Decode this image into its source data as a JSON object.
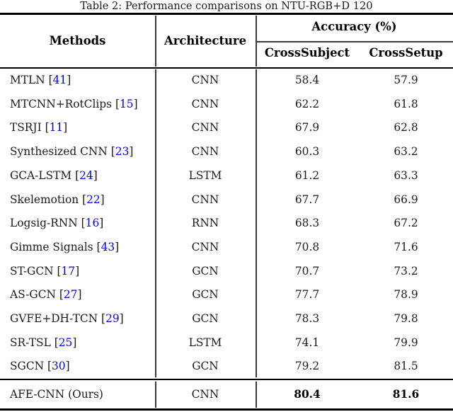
{
  "caption": "Table 2: Performance comparisons on NTU-RGB+D 120",
  "colors": {
    "citation_link": "#0000e0",
    "rule": "#000000",
    "text": "#1a1a1a"
  },
  "header": {
    "methods": "Methods",
    "architecture": "Architecture",
    "accuracy_group": "Accuracy (%)",
    "cross_subject": "CrossSubject",
    "cross_setup": "CrossSetup"
  },
  "rows": [
    {
      "method": "MTLN",
      "ref": "41",
      "architecture": "CNN",
      "cross_subject": "58.4",
      "cross_setup": "57.9"
    },
    {
      "method": "MTCNN+RotClips",
      "ref": "15",
      "architecture": "CNN",
      "cross_subject": "62.2",
      "cross_setup": "61.8"
    },
    {
      "method": "TSRJI",
      "ref": "11",
      "architecture": "CNN",
      "cross_subject": "67.9",
      "cross_setup": "62.8"
    },
    {
      "method": "Synthesized CNN",
      "ref": "23",
      "architecture": "CNN",
      "cross_subject": "60.3",
      "cross_setup": "63.2"
    },
    {
      "method": "GCA-LSTM",
      "ref": "24",
      "architecture": "LSTM",
      "cross_subject": "61.2",
      "cross_setup": "63.3"
    },
    {
      "method": "Skelemotion",
      "ref": "22",
      "architecture": "CNN",
      "cross_subject": "67.7",
      "cross_setup": "66.9"
    },
    {
      "method": "Logsig-RNN",
      "ref": "16",
      "architecture": "RNN",
      "cross_subject": "68.3",
      "cross_setup": "67.2"
    },
    {
      "method": "Gimme Signals",
      "ref": "43",
      "architecture": "CNN",
      "cross_subject": "70.8",
      "cross_setup": "71.6"
    },
    {
      "method": "ST-GCN",
      "ref": "17",
      "architecture": "GCN",
      "cross_subject": "70.7",
      "cross_setup": "73.2"
    },
    {
      "method": "AS-GCN",
      "ref": "27",
      "architecture": "GCN",
      "cross_subject": "77.7",
      "cross_setup": "78.9"
    },
    {
      "method": "GVFE+DH-TCN",
      "ref": "29",
      "architecture": "GCN",
      "cross_subject": "78.3",
      "cross_setup": "79.8"
    },
    {
      "method": "SR-TSL",
      "ref": "25",
      "architecture": "LSTM",
      "cross_subject": "74.1",
      "cross_setup": "79.9"
    },
    {
      "method": "SGCN",
      "ref": "30",
      "architecture": "GCN",
      "cross_subject": "79.2",
      "cross_setup": "81.5"
    }
  ],
  "ours_row": {
    "method": "AFE-CNN (Ours)",
    "ref": null,
    "architecture": "CNN",
    "cross_subject": "80.4",
    "cross_setup": "81.6",
    "bold": true
  },
  "chart_data": {
    "type": "table",
    "title": "Table 2: Performance comparisons on NTU-RGB+D 120",
    "columns": [
      "Methods",
      "Architecture",
      "CrossSubject",
      "CrossSetup"
    ],
    "column_groups": [
      {
        "label": "Accuracy (%)",
        "spans": [
          "CrossSubject",
          "CrossSetup"
        ]
      }
    ],
    "categories": [
      "MTLN [41]",
      "MTCNN+RotClips [15]",
      "TSRJI [11]",
      "Synthesized CNN [23]",
      "GCA-LSTM [24]",
      "Skelemotion [22]",
      "Logsig-RNN [16]",
      "Gimme Signals [43]",
      "ST-GCN [17]",
      "AS-GCN [27]",
      "GVFE+DH-TCN [29]",
      "SR-TSL [25]",
      "SGCN [30]",
      "AFE-CNN (Ours)"
    ],
    "series": [
      {
        "name": "CrossSubject",
        "values": [
          58.4,
          62.2,
          67.9,
          60.3,
          61.2,
          67.7,
          68.3,
          70.8,
          70.7,
          77.7,
          78.3,
          74.1,
          79.2,
          80.4
        ]
      },
      {
        "name": "CrossSetup",
        "values": [
          57.9,
          61.8,
          62.8,
          63.2,
          63.3,
          66.9,
          67.2,
          71.6,
          73.2,
          78.9,
          79.8,
          79.9,
          81.5,
          81.6
        ]
      }
    ],
    "architectures": [
      "CNN",
      "CNN",
      "CNN",
      "CNN",
      "LSTM",
      "CNN",
      "RNN",
      "CNN",
      "GCN",
      "GCN",
      "GCN",
      "LSTM",
      "GCN",
      "CNN"
    ],
    "ylabel": "Accuracy (%)",
    "highlighted_row": "AFE-CNN (Ours)"
  }
}
